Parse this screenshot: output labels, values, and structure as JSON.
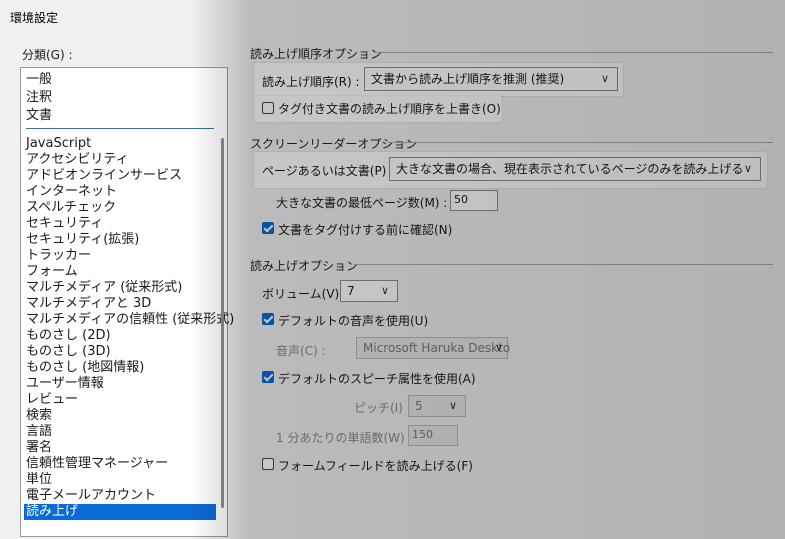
{
  "window": {
    "title": "環境設定"
  },
  "categories": {
    "label": "分類(G) :",
    "top_items": [
      "一般",
      "注釈",
      "文書"
    ],
    "items": [
      "JavaScript",
      "アクセシビリティ",
      "アドビオンラインサービス",
      "インターネット",
      "スペルチェック",
      "セキュリティ",
      "セキュリティ(拡張)",
      "トラッカー",
      "フォーム",
      "マルチメディア (従来形式)",
      "マルチメディアと 3D",
      "マルチメディアの信頼性 (従来形式)",
      "ものさし (2D)",
      "ものさし (3D)",
      "ものさし (地図情報)",
      "ユーザー情報",
      "レビュー",
      "検索",
      "言語",
      "署名",
      "信頼性管理マネージャー",
      "単位",
      "電子メールアカウント",
      "読み上げ"
    ],
    "selected": "読み上げ"
  },
  "reading_order": {
    "group_title": "読み上げ順序オプション",
    "order_label": "読み上げ順序(R) :",
    "order_value": "文書から読み上げ順序を推測 (推奨)",
    "override_label": "タグ付き文書の読み上げ順序を上書き(O)",
    "override_checked": false
  },
  "screen_reader": {
    "group_title": "スクリーンリーダーオプション",
    "pages_label": "ページあるいは文書(P) :",
    "pages_value": "大きな文書の場合、現在表示されているページのみを読み上げる",
    "min_pages_label": "大きな文書の最低ページ数(M) :",
    "min_pages_value": "50",
    "confirm_label": "文書をタグ付けする前に確認(N)",
    "confirm_checked": true
  },
  "read_out_loud": {
    "group_title": "読み上げオプション",
    "volume_label": "ボリューム(V) :",
    "volume_value": "7",
    "default_voice_label": "デフォルトの音声を使用(U)",
    "default_voice_checked": true,
    "voice_label": "音声(C) :",
    "voice_value": "Microsoft Haruka Deskto",
    "default_speech_label": "デフォルトのスピーチ属性を使用(A)",
    "default_speech_checked": true,
    "pitch_label": "ピッチ(I) :",
    "pitch_value": "5",
    "wpm_label": "1 分あたりの単語数(W) :",
    "wpm_value": "150",
    "form_fields_label": "フォームフィールドを読み上げる(F)",
    "form_fields_checked": false
  },
  "icons": {
    "dropdown": "chevron-down-icon",
    "check": "checkmark-icon"
  }
}
